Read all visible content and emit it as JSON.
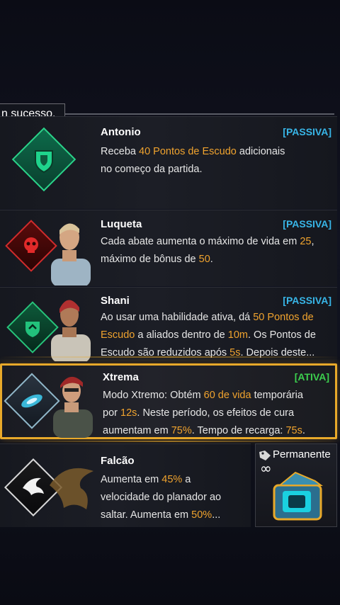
{
  "toast": {
    "text": "n sucesso."
  },
  "skills": [
    {
      "name": "Antonio",
      "tag": "[PASSIVA]",
      "desc": [
        {
          "t": "Receba "
        },
        {
          "t": "40 Pontos de Escudo",
          "h": true
        },
        {
          "t": " adicionais"
        },
        {
          "br": true
        },
        {
          "t": "no começo da partida."
        }
      ]
    },
    {
      "name": "Luqueta",
      "tag": "[PASSIVA]",
      "desc": [
        {
          "t": "Cada abate aumenta o máximo de vida em "
        },
        {
          "t": "25",
          "h": true
        },
        {
          "t": ","
        },
        {
          "br": true
        },
        {
          "t": "máximo de bônus de "
        },
        {
          "t": "50",
          "h": true
        },
        {
          "t": "."
        }
      ]
    },
    {
      "name": "Shani",
      "tag": "[PASSIVA]",
      "desc": [
        {
          "t": "Ao usar uma habilidade ativa, dá "
        },
        {
          "t": "50 Pontos de",
          "h": true
        },
        {
          "br": true
        },
        {
          "t": "Escudo",
          "h": true
        },
        {
          "t": " a aliados dentro de "
        },
        {
          "t": "10m",
          "h": true
        },
        {
          "t": ". Os Pontos de"
        },
        {
          "br": true
        },
        {
          "t": "Escudo são reduzidos após "
        },
        {
          "t": "5s",
          "h": true
        },
        {
          "t": ". Depois deste..."
        }
      ]
    },
    {
      "name": "Xtrema",
      "tag": "[ATIVA]",
      "desc": [
        {
          "t": "Modo Xtremo: Obtém "
        },
        {
          "t": "60 de vida",
          "h": true
        },
        {
          "t": " temporária"
        },
        {
          "br": true
        },
        {
          "t": "por "
        },
        {
          "t": "12s",
          "h": true
        },
        {
          "t": ". Neste período, os efeitos de cura"
        },
        {
          "br": true
        },
        {
          "t": "aumentam em "
        },
        {
          "t": "75%",
          "h": true
        },
        {
          "t": ". Tempo de recarga: "
        },
        {
          "t": "75s",
          "h": true
        },
        {
          "t": "."
        }
      ]
    },
    {
      "name": "Falcão",
      "tag": "",
      "desc": [
        {
          "t": "Aumenta em "
        },
        {
          "t": "45%",
          "h": true
        },
        {
          "t": " a"
        },
        {
          "br": true
        },
        {
          "t": "velocidade do planador ao"
        },
        {
          "br": true
        },
        {
          "t": "saltar. Aumenta em "
        },
        {
          "t": "50%",
          "h": true
        },
        {
          "t": "..."
        }
      ]
    }
  ],
  "permanent": {
    "label": "Permanente",
    "badge": "∞"
  },
  "colors": {
    "highlight": "#f0a32e",
    "passive": "#38b6e8",
    "active": "#3ccf4e",
    "selected_border": "#e8a92a"
  }
}
